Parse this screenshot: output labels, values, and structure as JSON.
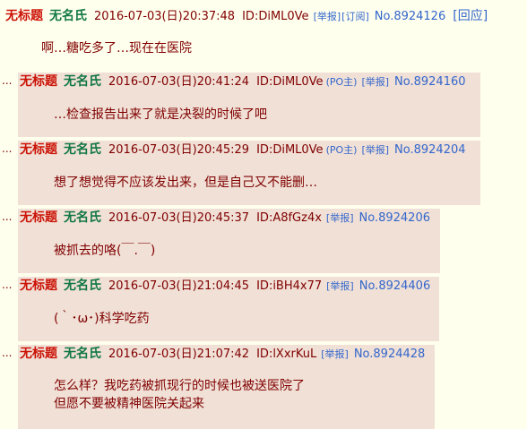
{
  "op": {
    "title": "无标题",
    "name": "无名氏",
    "time": "2016-07-03(日)20:37:48",
    "uid": "ID:DiML0Ve",
    "report": "[举报]",
    "subscribe": "[订阅]",
    "no": "No.8924126",
    "reply": "[回应]",
    "content": "啊…糖吃多了…现在在医院"
  },
  "replies": [
    {
      "dots": "...",
      "title": "无标题",
      "name": "无名氏",
      "time": "2016-07-03(日)20:41:24",
      "uid": "ID:DiML0Ve",
      "po": "(PO主)",
      "report": "[举报]",
      "no": "No.8924160",
      "content": "…检查报告出来了就是决裂的时候了吧"
    },
    {
      "dots": "...",
      "title": "无标题",
      "name": "无名氏",
      "time": "2016-07-03(日)20:45:29",
      "uid": "ID:DiML0Ve",
      "po": "(PO主)",
      "report": "[举报]",
      "no": "No.8924204",
      "content": "想了想觉得不应该发出来，但是自己又不能删…"
    },
    {
      "dots": "...",
      "title": "无标题",
      "name": "无名氏",
      "time": "2016-07-03(日)20:45:37",
      "uid": "ID:A8fGz4x",
      "report": "[举报]",
      "no": "No.8924206",
      "content": "被抓去的咯(￣.￣)"
    },
    {
      "dots": "...",
      "title": "无标题",
      "name": "无名氏",
      "time": "2016-07-03(日)21:04:45",
      "uid": "ID:iBH4x77",
      "report": "[举报]",
      "no": "No.8924406",
      "content": "(｀･ω･)科学吃药"
    },
    {
      "dots": "...",
      "title": "无标题",
      "name": "无名氏",
      "time": "2016-07-03(日)21:07:42",
      "uid": "ID:lXxrKuL",
      "report": "[举报]",
      "no": "No.8924428",
      "content": "怎么样？我吃药被抓现行的时候也被送医院了\n但愿不要被精神医院关起来"
    }
  ]
}
